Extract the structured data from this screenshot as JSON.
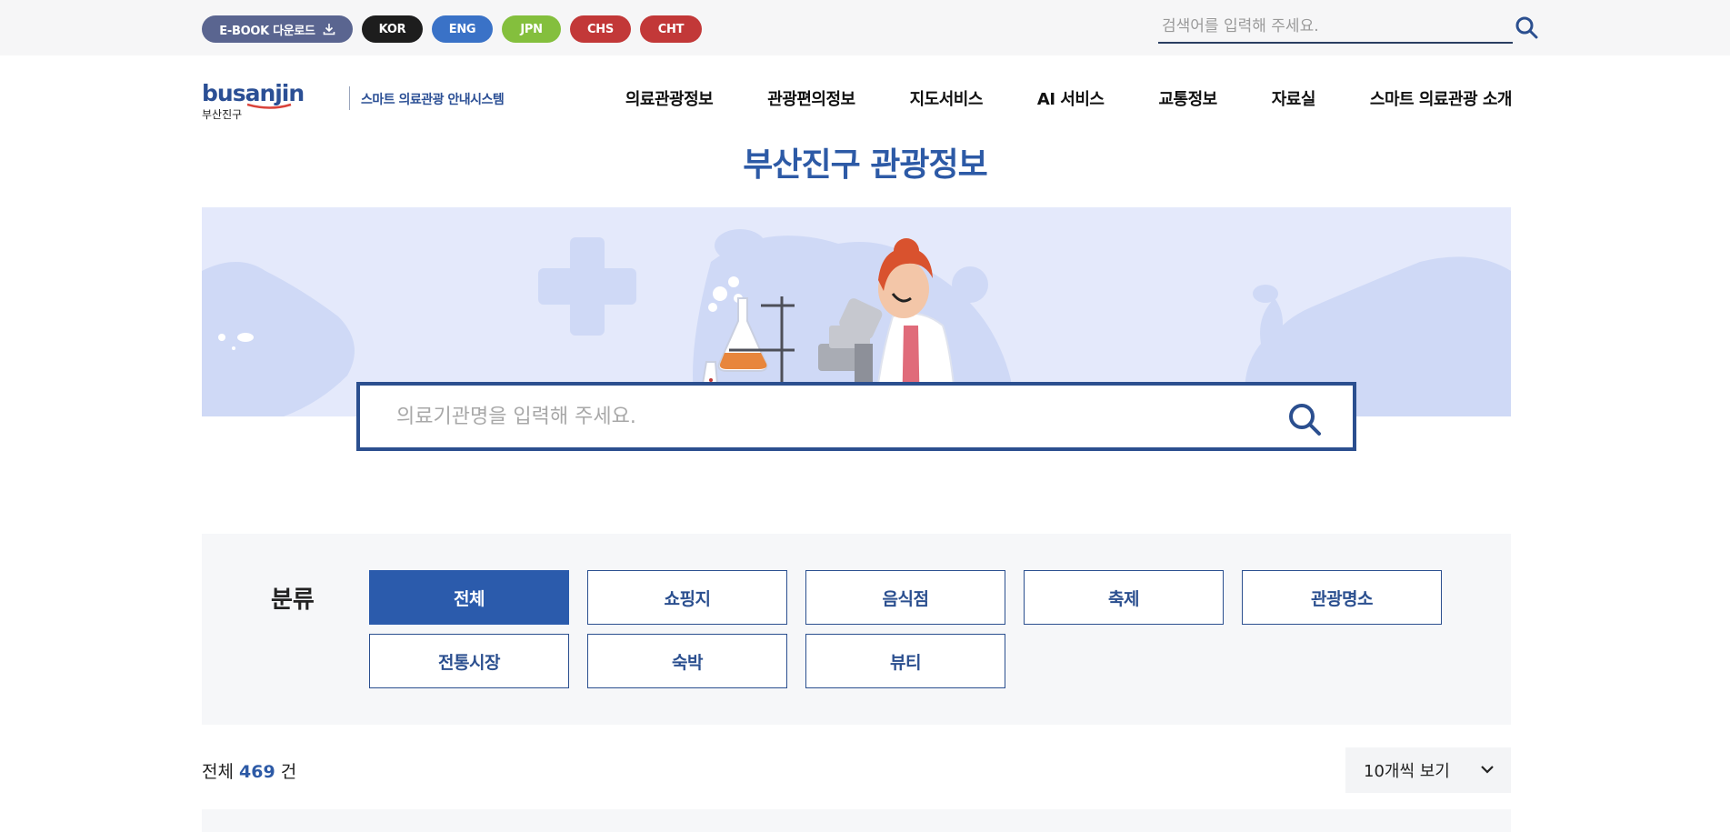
{
  "topbar": {
    "ebook_label": "E-BOOK 다운로드",
    "languages": [
      "KOR",
      "ENG",
      "JPN",
      "CHS",
      "CHT"
    ],
    "search_placeholder": "검색어를 입력해 주세요."
  },
  "header": {
    "logo_word": "busanjin",
    "logo_sub": "부산진구",
    "logo_tagline": "스마트 의료관광 안내시스템",
    "nav": [
      "의료관광정보",
      "관광편의정보",
      "지도서비스",
      "AI 서비스",
      "교통정보",
      "자료실",
      "스마트 의료관광 소개"
    ]
  },
  "page_title": "부산진구 관광정보",
  "main_search": {
    "placeholder": "의료기관명을 입력해 주세요."
  },
  "filter": {
    "label": "분류",
    "categories": [
      "전체",
      "쇼핑지",
      "음식점",
      "축제",
      "관광명소",
      "전통시장",
      "숙박",
      "뷰티"
    ],
    "active": "전체"
  },
  "results": {
    "prefix": "전체",
    "total": "469",
    "suffix": "건",
    "per_page": "10개씩 보기"
  },
  "colors": {
    "primary": "#2b5bac",
    "title_blue": "#2d5aa6",
    "banner_bg": "#e4e9fb",
    "kor": "#1d1d1d",
    "eng": "#3a72c7",
    "jpn": "#84bf3d",
    "chs": "#c23838",
    "cht": "#c23838"
  }
}
